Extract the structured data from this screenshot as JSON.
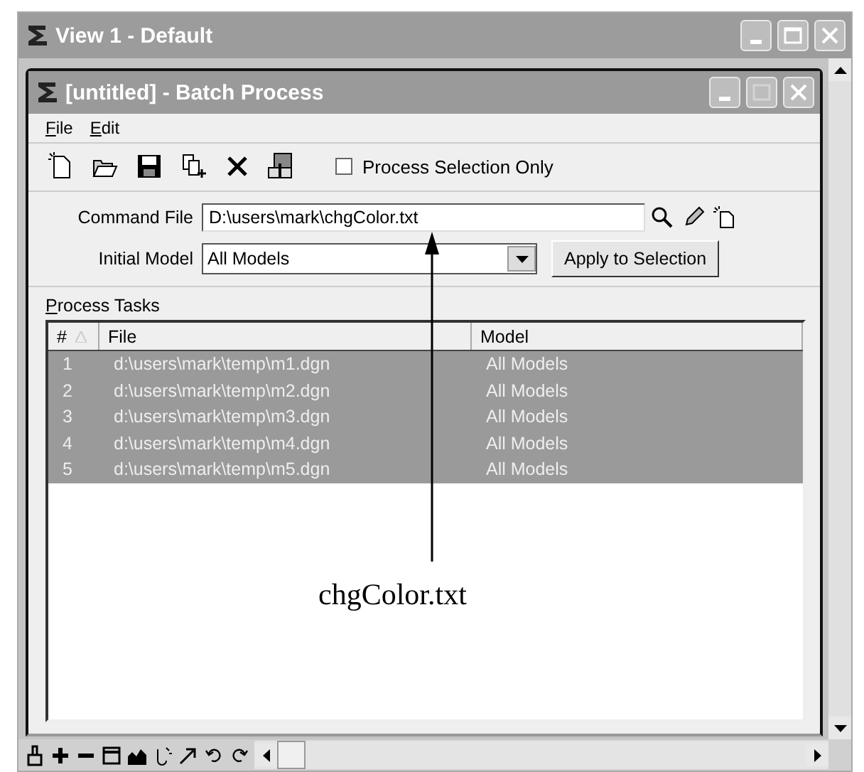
{
  "outer_window": {
    "title": "View 1 - Default"
  },
  "dialog": {
    "title": "[untitled] - Batch Process"
  },
  "menu": [
    "File",
    "Edit"
  ],
  "toolbar": {
    "process_selection_only": {
      "label": "Process Selection Only",
      "checked": false
    }
  },
  "command_file": {
    "label": "Command File",
    "value": "D:\\users\\mark\\chgColor.txt"
  },
  "initial_model": {
    "label": "Initial Model",
    "value": "All Models"
  },
  "apply_button": "Apply to Selection",
  "tasks": {
    "label": "Process Tasks",
    "columns": [
      "#",
      "File",
      "Model"
    ],
    "rows": [
      {
        "number": "1",
        "file": "d:\\users\\mark\\temp\\m1.dgn",
        "model": "All Models",
        "selected": true
      },
      {
        "number": "2",
        "file": "d:\\users\\mark\\temp\\m2.dgn",
        "model": "All Models",
        "selected": true
      },
      {
        "number": "3",
        "file": "d:\\users\\mark\\temp\\m3.dgn",
        "model": "All Models",
        "selected": true
      },
      {
        "number": "4",
        "file": "d:\\users\\mark\\temp\\m4.dgn",
        "model": "All Models",
        "selected": true
      },
      {
        "number": "5",
        "file": "d:\\users\\mark\\temp\\m5.dgn",
        "model": "All Models",
        "selected": true
      }
    ]
  },
  "callout": "chgColor.txt"
}
